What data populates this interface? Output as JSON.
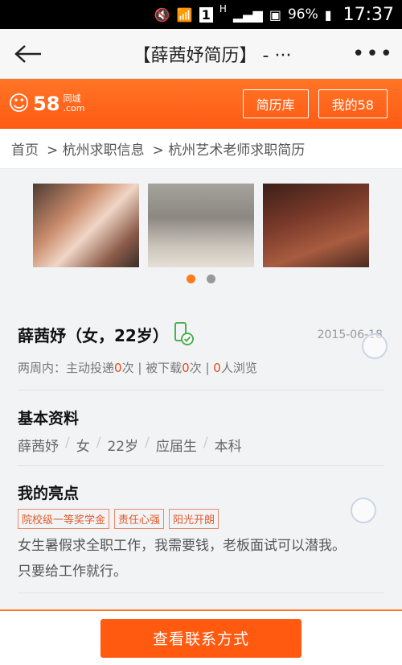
{
  "statusbar": {
    "battery": "96%",
    "time": "17:37",
    "sim": "1",
    "net": "H"
  },
  "titlebar": {
    "title": "【薛茜妤简历】 - ···"
  },
  "brand": {
    "logo_num": "58",
    "logo_sub1": "同城",
    "logo_sub2": ".com",
    "btn_library": "简历库",
    "btn_my58": "我的58"
  },
  "breadcrumb": {
    "items": [
      "首页",
      "> 杭州求职信息",
      "> 杭州艺术老师求职简历"
    ]
  },
  "resume": {
    "name_line": "薛茜妤（女，22岁）",
    "date": "2015-06-18",
    "stats_prefix": "两周内：主动投递",
    "stats_apply": "0",
    "stats_mid1": "次 | 被下载",
    "stats_download": "0",
    "stats_mid2": "次 | ",
    "stats_view": "0",
    "stats_suffix": "人浏览"
  },
  "basic": {
    "title": "基本资料",
    "items": [
      "薛茜妤",
      "女",
      "22岁",
      "应届生",
      "本科"
    ]
  },
  "highlights": {
    "title": "我的亮点",
    "tags": [
      "院校级一等奖学金",
      "责任心强",
      "阳光开朗"
    ],
    "line1": "女生暑假求全职工作，我需要钱，老板面试可以潜我。",
    "line2": "只要给工作就行。"
  },
  "bottom": {
    "contact_label": "查看联系方式"
  },
  "colors": {
    "brand": "#ff5a14",
    "accent": "#ff7a1a",
    "highlight_num": "#e64a19"
  }
}
